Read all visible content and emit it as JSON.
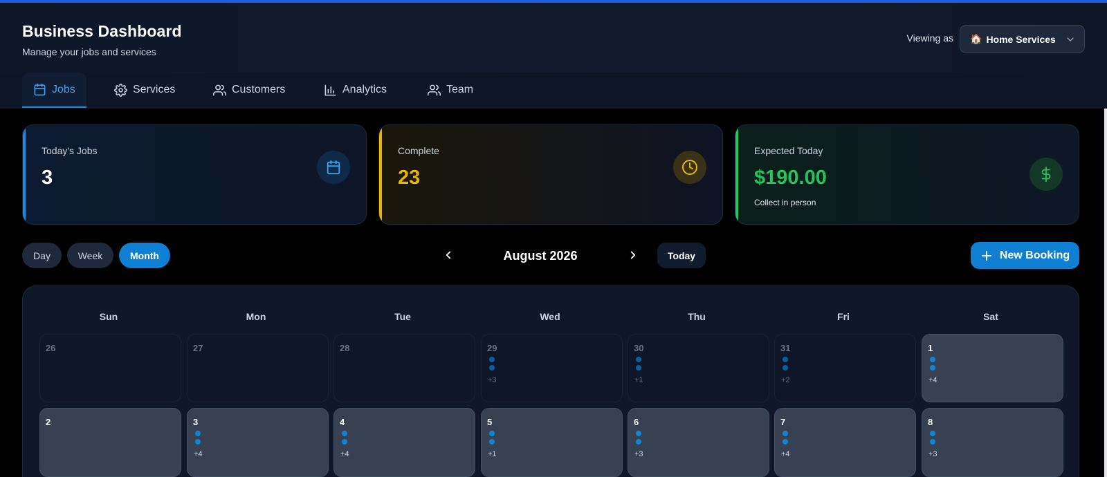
{
  "colors": {
    "accent": "#0f7fd2",
    "active_tab": "#38a3f1",
    "jobs_stripe": "#1b8be0",
    "complete_stripe": "#eab308",
    "expected_stripe": "#22c55e"
  },
  "header": {
    "title": "Business Dashboard",
    "subtitle": "Manage your jobs and services",
    "viewing_label": "Viewing as",
    "business_icon": "🏠",
    "business_selected": "Home Services"
  },
  "tabs": [
    {
      "label": "Jobs",
      "icon": "calendar-icon",
      "active": true
    },
    {
      "label": "Services",
      "icon": "gear-icon",
      "active": false
    },
    {
      "label": "Customers",
      "icon": "users-icon",
      "active": false
    },
    {
      "label": "Analytics",
      "icon": "bar-chart-icon",
      "active": false
    },
    {
      "label": "Team",
      "icon": "users-icon",
      "active": false
    }
  ],
  "stats": {
    "today_jobs": {
      "label": "Today's Jobs",
      "value": "3",
      "icon": "calendar-icon"
    },
    "complete": {
      "label": "Complete",
      "value": "23",
      "icon": "clock-icon"
    },
    "expected": {
      "label": "Expected Today",
      "value": "$190.00",
      "note": "Collect in person",
      "icon": "dollar-icon"
    }
  },
  "view_modes": [
    {
      "label": "Day",
      "active": false
    },
    {
      "label": "Week",
      "active": false
    },
    {
      "label": "Month",
      "active": true
    }
  ],
  "calendar_nav": {
    "month_label": "August 2026",
    "today_label": "Today",
    "new_booking_label": "New Booking"
  },
  "calendar": {
    "weekdays": [
      "Sun",
      "Mon",
      "Tue",
      "Wed",
      "Thu",
      "Fri",
      "Sat"
    ],
    "weeks": [
      [
        {
          "day": "26",
          "current": false,
          "dots": 0,
          "more": ""
        },
        {
          "day": "27",
          "current": false,
          "dots": 0,
          "more": ""
        },
        {
          "day": "28",
          "current": false,
          "dots": 0,
          "more": ""
        },
        {
          "day": "29",
          "current": false,
          "dots": 2,
          "more": "+3"
        },
        {
          "day": "30",
          "current": false,
          "dots": 2,
          "more": "+1"
        },
        {
          "day": "31",
          "current": false,
          "dots": 2,
          "more": "+2"
        },
        {
          "day": "1",
          "current": true,
          "dots": 2,
          "more": "+4"
        }
      ],
      [
        {
          "day": "2",
          "current": true,
          "dots": 0,
          "more": ""
        },
        {
          "day": "3",
          "current": true,
          "dots": 2,
          "more": "+4"
        },
        {
          "day": "4",
          "current": true,
          "dots": 2,
          "more": "+4"
        },
        {
          "day": "5",
          "current": true,
          "dots": 2,
          "more": "+1"
        },
        {
          "day": "6",
          "current": true,
          "dots": 2,
          "more": "+3"
        },
        {
          "day": "7",
          "current": true,
          "dots": 2,
          "more": "+4"
        },
        {
          "day": "8",
          "current": true,
          "dots": 2,
          "more": "+3"
        }
      ]
    ]
  }
}
